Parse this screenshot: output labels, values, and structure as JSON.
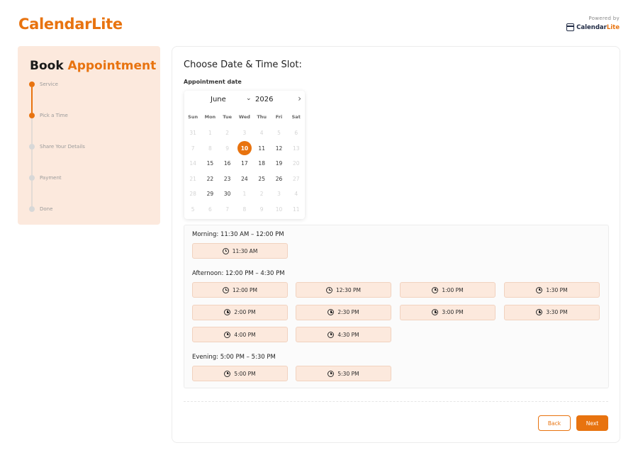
{
  "brand": {
    "logo": "CalendarLite",
    "powered_label": "Powered by",
    "powered_brand_a": "Calendar",
    "powered_brand_b": "Lite",
    "accent_color": "#e8730f"
  },
  "sidebar": {
    "title_a": "Book ",
    "title_b": "Appointment",
    "steps": [
      {
        "label": "Service",
        "done": true
      },
      {
        "label": "Pick a Time",
        "done": true
      },
      {
        "label": "Share Your Details",
        "done": false
      },
      {
        "label": "Payment",
        "done": false
      },
      {
        "label": "Done",
        "done": false
      }
    ]
  },
  "main": {
    "title": "Choose Date & Time Slot:",
    "date_label": "Appointment date"
  },
  "calendar": {
    "month": "June",
    "year": "2026",
    "next_icon": "chevron-right-icon",
    "weekdays": [
      "Sun",
      "Mon",
      "Tue",
      "Wed",
      "Thu",
      "Fri",
      "Sat"
    ],
    "weeks": [
      [
        {
          "d": "31",
          "muted": true
        },
        {
          "d": "1",
          "muted": true
        },
        {
          "d": "2",
          "muted": true
        },
        {
          "d": "3",
          "muted": true
        },
        {
          "d": "4",
          "muted": true
        },
        {
          "d": "5",
          "muted": true
        },
        {
          "d": "6",
          "muted": true
        }
      ],
      [
        {
          "d": "7",
          "muted": true
        },
        {
          "d": "8",
          "muted": true
        },
        {
          "d": "9",
          "muted": true
        },
        {
          "d": "10",
          "selected": true
        },
        {
          "d": "11"
        },
        {
          "d": "12"
        },
        {
          "d": "13",
          "muted": true
        }
      ],
      [
        {
          "d": "14",
          "muted": true
        },
        {
          "d": "15"
        },
        {
          "d": "16"
        },
        {
          "d": "17"
        },
        {
          "d": "18"
        },
        {
          "d": "19"
        },
        {
          "d": "20",
          "muted": true
        }
      ],
      [
        {
          "d": "21",
          "muted": true
        },
        {
          "d": "22"
        },
        {
          "d": "23"
        },
        {
          "d": "24"
        },
        {
          "d": "25"
        },
        {
          "d": "26"
        },
        {
          "d": "27",
          "muted": true
        }
      ],
      [
        {
          "d": "28",
          "muted": true
        },
        {
          "d": "29"
        },
        {
          "d": "30"
        },
        {
          "d": "1",
          "muted": true
        },
        {
          "d": "2",
          "muted": true
        },
        {
          "d": "3",
          "muted": true
        },
        {
          "d": "4",
          "muted": true
        }
      ],
      [
        {
          "d": "5",
          "muted": true
        },
        {
          "d": "6",
          "muted": true
        },
        {
          "d": "7",
          "muted": true
        },
        {
          "d": "8",
          "muted": true
        },
        {
          "d": "9",
          "muted": true
        },
        {
          "d": "10",
          "muted": true
        },
        {
          "d": "11",
          "muted": true
        }
      ]
    ]
  },
  "slots": {
    "groups": [
      {
        "title": "Morning: 11:30 AM – 12:00 PM",
        "times": [
          "11:30 AM"
        ]
      },
      {
        "title": "Afternoon: 12:00 PM – 4:30 PM",
        "times": [
          "12:00 PM",
          "12:30 PM",
          "1:00 PM",
          "1:30 PM",
          "2:00 PM",
          "2:30 PM",
          "3:00 PM",
          "3:30 PM",
          "4:00 PM",
          "4:30 PM"
        ]
      },
      {
        "title": "Evening: 5:00 PM – 5:30 PM",
        "times": [
          "5:00 PM",
          "5:30 PM"
        ]
      }
    ]
  },
  "footer": {
    "back_label": "Back",
    "next_label": "Next"
  }
}
